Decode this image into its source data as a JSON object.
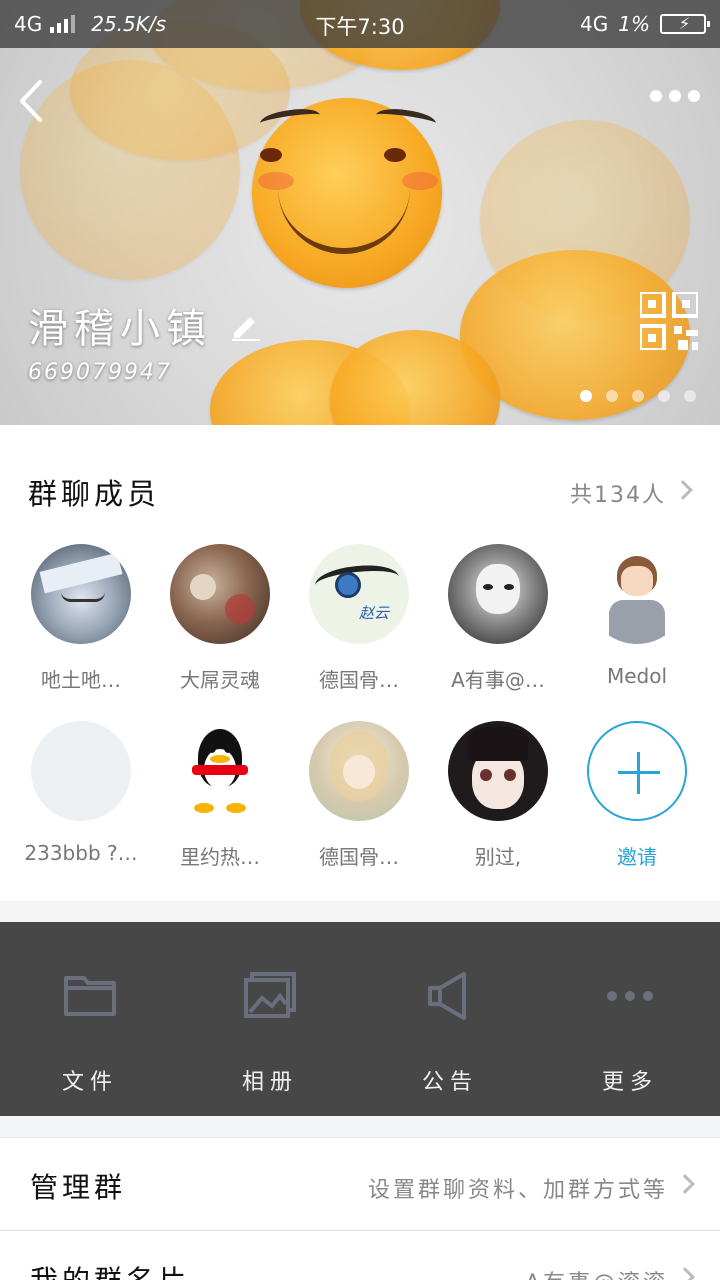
{
  "status_bar": {
    "network": "4G",
    "speed": "25.5K/s",
    "time": "下午7:30",
    "network_right": "4G",
    "battery": "1%"
  },
  "header": {
    "group_name": "滑稽小镇",
    "group_id": "669079947",
    "icons": [
      "back-icon",
      "more-icon",
      "edit-icon",
      "qr-code-icon"
    ],
    "carousel_pages": 5,
    "carousel_active": 1
  },
  "members": {
    "title": "群聊成员",
    "count": "共134人",
    "list": [
      {
        "name": "吔土吔…"
      },
      {
        "name": "大屌灵魂"
      },
      {
        "name": "德国骨…"
      },
      {
        "name": "A有事@…"
      },
      {
        "name": "Medol"
      },
      {
        "name": "233bbb ?…"
      },
      {
        "name": "里约热…"
      },
      {
        "name": "德国骨…"
      },
      {
        "name": "别过,"
      }
    ],
    "invite_label": "邀请",
    "accent_color": "#25a5d8"
  },
  "actions": [
    {
      "label": "文件",
      "icon": "folder-icon"
    },
    {
      "label": "相册",
      "icon": "album-icon"
    },
    {
      "label": "公告",
      "icon": "announcement-icon"
    },
    {
      "label": "更多",
      "icon": "more-dots-icon"
    }
  ],
  "rows": [
    {
      "title": "管理群",
      "value": "设置群聊资料、加群方式等"
    },
    {
      "title": "我的群名片",
      "value": "A有事@滚滚"
    }
  ]
}
